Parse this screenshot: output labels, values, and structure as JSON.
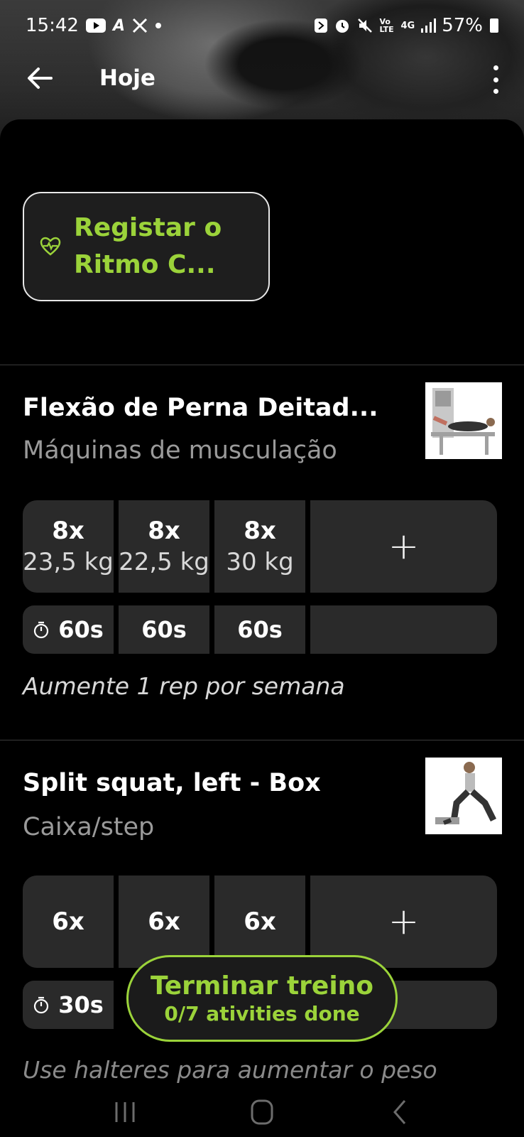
{
  "status_bar": {
    "time": "15:42",
    "battery": "57%",
    "network": "4G",
    "volte": "Vo LTE",
    "icons": [
      "youtube-icon",
      "a-icon",
      "x-icon",
      "dot-icon",
      "nfc-icon",
      "alarm-icon",
      "mute-icon",
      "volte-icon",
      "4g-icon",
      "signal-icon",
      "battery-icon"
    ]
  },
  "app_bar": {
    "title": "Hoje"
  },
  "heart_rate_button": {
    "label": "Registar o Ritmo C..."
  },
  "exercises": [
    {
      "title": "Flexão de Perna Deitad...",
      "equipment": "Máquinas de musculação",
      "sets": [
        {
          "reps": "8x",
          "weight": "23,5 kg",
          "rest": "60s"
        },
        {
          "reps": "8x",
          "weight": "22,5 kg",
          "rest": "60s"
        },
        {
          "reps": "8x",
          "weight": "30 kg",
          "rest": "60s"
        }
      ],
      "add_label": "+",
      "note": "Aumente 1 rep por semana"
    },
    {
      "title": "Split squat, left  - Box",
      "equipment": "Caixa/step",
      "sets": [
        {
          "reps": "6x",
          "rest": "30s"
        },
        {
          "reps": "6x"
        },
        {
          "reps": "6x"
        }
      ],
      "add_label": "+",
      "note": "Use halteres para aumentar o peso"
    }
  ],
  "finish_button": {
    "title": "Terminar treino",
    "subtitle": "0/7 ativities done"
  },
  "colors": {
    "accent": "#9bd33a",
    "background": "#000000",
    "cell": "#2a2a2a",
    "muted_text": "#9a9a9a"
  }
}
